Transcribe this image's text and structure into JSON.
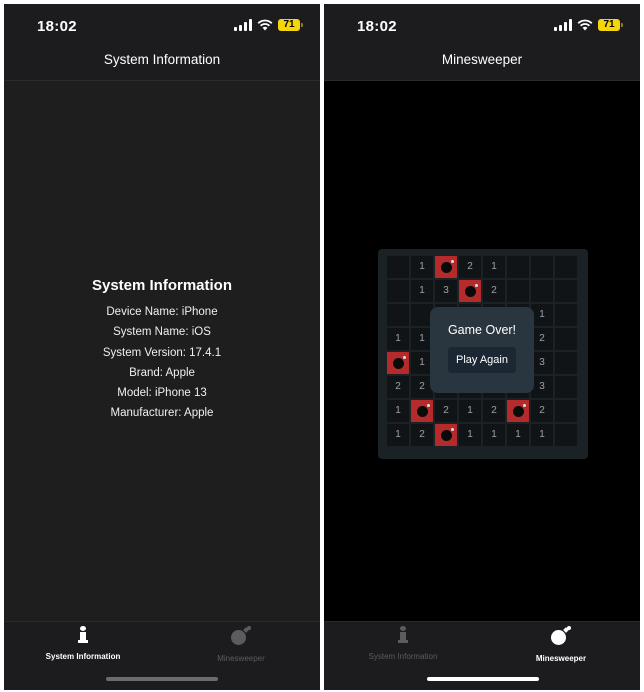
{
  "status": {
    "time": "18:02",
    "battery": "71"
  },
  "left": {
    "nav_title": "System Information",
    "info": {
      "title": "System Information",
      "lines": [
        "Device Name: iPhone",
        "System Name: iOS",
        "System Version: 17.4.1",
        "Brand: Apple",
        "Model: iPhone 13",
        "Manufacturer: Apple"
      ]
    }
  },
  "right": {
    "nav_title": "Minesweeper",
    "board": [
      [
        "",
        "1",
        "*",
        "2",
        "1",
        "",
        "",
        ""
      ],
      [
        "",
        "1",
        "3",
        "*",
        "2",
        "",
        "",
        ""
      ],
      [
        "",
        "",
        "",
        "",
        "",
        "",
        "1",
        ""
      ],
      [
        "1",
        "1",
        "",
        "",
        "",
        "",
        "2",
        ""
      ],
      [
        "*",
        "1",
        "",
        "",
        "",
        "",
        "3",
        ""
      ],
      [
        "2",
        "2",
        "",
        "",
        "",
        "",
        "3",
        ""
      ],
      [
        "1",
        "*",
        "2",
        "1",
        "2",
        "*",
        "2",
        ""
      ],
      [
        "1",
        "2",
        "*",
        "1",
        "1",
        "1",
        "1",
        ""
      ]
    ],
    "dialog": {
      "title": "Game Over!",
      "button": "Play Again"
    }
  },
  "tabs": [
    {
      "label": "System Information",
      "icon": "info-icon"
    },
    {
      "label": "Minesweeper",
      "icon": "bomb-icon"
    }
  ],
  "colors": {
    "mine_cell": "#b52a2a",
    "board_bg": "#1b2226",
    "dialog_bg": "#29363f",
    "battery": "#f5d60a"
  }
}
